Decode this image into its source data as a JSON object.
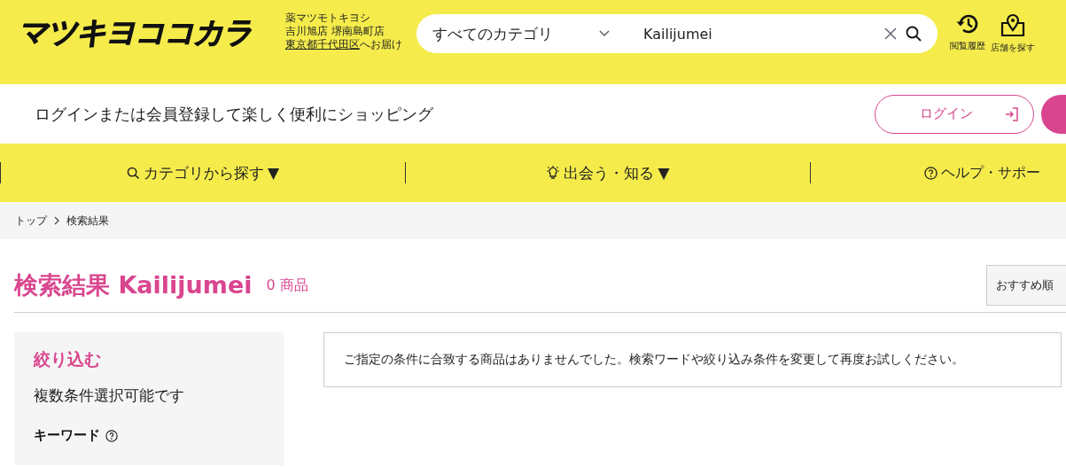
{
  "header": {
    "logo": "マツキヨココカラ",
    "store_lines": [
      "薬マツモトキヨシ",
      "吉川旭店 堺南島町店"
    ],
    "delivery": {
      "area": "東京都千代田区",
      "suffix": "へお届け"
    },
    "search": {
      "category": "すべてのカテゴリ",
      "value": "Kailijumei"
    },
    "shortcuts": [
      {
        "kind": "history",
        "label": "閲覧履歴"
      },
      {
        "kind": "store",
        "label": "店舗を探す"
      }
    ]
  },
  "login_bar": {
    "message": "ログインまたは会員登録して楽しく便利にショッピング",
    "button": "ログイン"
  },
  "nav": [
    {
      "kind": "search",
      "label": "カテゴリから探す",
      "caret": "▼"
    },
    {
      "kind": "bulb",
      "label": "出会う・知る",
      "caret": "▼"
    },
    {
      "kind": "help",
      "label": "ヘルプ・サポー"
    }
  ],
  "breadcrumb": [
    "トップ",
    "検索結果"
  ],
  "results": {
    "title": "検索結果",
    "keyword": "Kailijumei",
    "count": "0 商品",
    "sort": "おすすめ順",
    "message": "ご指定の条件に合致する商品はありませんでした。検索ワードや絞り込み条件を変更して再度お試しください。"
  },
  "filter": {
    "title": "絞り込む",
    "note": "複数条件選択可能です",
    "section": "キーワード"
  }
}
